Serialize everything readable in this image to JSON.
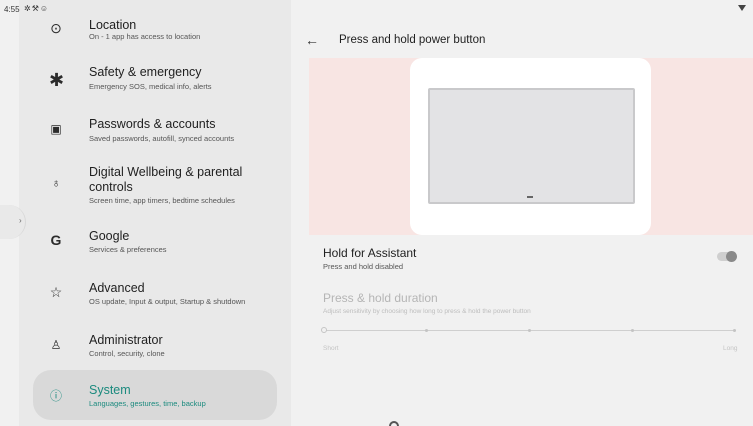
{
  "status_bar": {
    "time": "4:55",
    "icons": [
      "gear-icon",
      "wrench-icon",
      "android-icon",
      "wifi-icon"
    ]
  },
  "settings_list": [
    {
      "icon": "location-icon",
      "title": "Location",
      "subtitle": "On - 1 app has access to location"
    },
    {
      "icon": "asterisk-icon",
      "title": "Safety & emergency",
      "subtitle": "Emergency SOS, medical info, alerts"
    },
    {
      "icon": "account-box-icon",
      "title": "Passwords & accounts",
      "subtitle": "Saved passwords, autofill, synced accounts"
    },
    {
      "icon": "wellbeing-icon",
      "title": "Digital Wellbeing & parental controls",
      "subtitle": "Screen time, app timers, bedtime schedules"
    },
    {
      "icon": "google-icon",
      "title": "Google",
      "subtitle": "Services & preferences"
    },
    {
      "icon": "star-outline-icon",
      "title": "Advanced",
      "subtitle": "OS update, Input & output, Startup & shutdown"
    },
    {
      "icon": "admin-icon",
      "title": "Administrator",
      "subtitle": "Control, security, clone"
    },
    {
      "icon": "info-icon",
      "title": "System",
      "subtitle": "Languages, gestures, time, backup",
      "selected": true
    }
  ],
  "detail": {
    "back_icon": "arrow-back-icon",
    "title": "Press and hold power button",
    "hold_for_assistant": {
      "title": "Hold for Assistant",
      "subtitle": "Press and hold disabled",
      "enabled": false
    },
    "press_hold_duration": {
      "title": "Press & hold duration",
      "subtitle": "Adjust sensitivity by choosing how long to press & hold the power button",
      "min_label": "Short",
      "max_label": "Long",
      "value_fraction": 0,
      "disabled": true
    }
  },
  "colors": {
    "accent": "#1b8a7e",
    "hero_background": "#f8e5e3"
  }
}
